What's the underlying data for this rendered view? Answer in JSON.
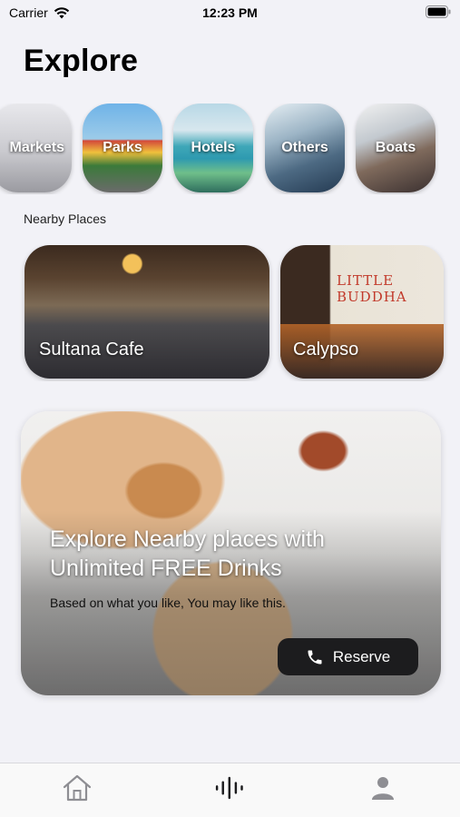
{
  "status_bar": {
    "carrier": "Carrier",
    "time": "12:23 PM"
  },
  "page_title": "Explore",
  "categories": [
    {
      "label": "Markets"
    },
    {
      "label": "Parks"
    },
    {
      "label": "Hotels"
    },
    {
      "label": "Others"
    },
    {
      "label": "Boats"
    }
  ],
  "nearby": {
    "section_label": "Nearby Places",
    "places": [
      {
        "label": "Sultana Cafe"
      },
      {
        "label": "Calypso",
        "sign_line1": "LITTLE",
        "sign_line2": "BUDDHA"
      }
    ]
  },
  "promo": {
    "title": "Explore Nearby places with Unlimited FREE Drinks",
    "subtitle": "Based on what you like, You may like this.",
    "button_label": "Reserve"
  },
  "tab_bar": {
    "items": [
      {
        "icon": "home-icon"
      },
      {
        "icon": "audio-wave-icon"
      },
      {
        "icon": "person-icon"
      }
    ]
  },
  "colors": {
    "background": "#f2f2f7",
    "button": "#1c1c1e",
    "tab_icon": "#8e8e93"
  }
}
